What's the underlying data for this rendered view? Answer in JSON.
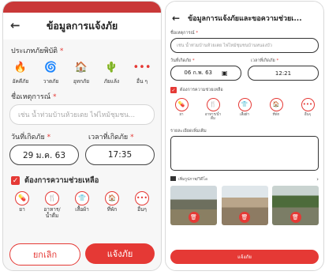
{
  "form_main": {
    "title": "ข้อมูลการแจ้งภัย",
    "type_label": "ประเภทภัยพิบัติ",
    "types": [
      {
        "icon": "fire-icon",
        "glyph": "🔥",
        "label": "อัคคีภัย"
      },
      {
        "icon": "storm-icon",
        "glyph": "🌀",
        "label": "วาตภัย"
      },
      {
        "icon": "flood-icon",
        "glyph": "🏠",
        "label": "อุทกภัย"
      },
      {
        "icon": "drought-icon",
        "glyph": "🌵",
        "label": "ภัยแล้ง"
      },
      {
        "icon": "more-icon",
        "glyph": "•••",
        "label": "อื่น ๆ"
      }
    ],
    "name_label": "ชื่อเหตุการณ์",
    "name_placeholder": "เช่น น้ำท่วมบ้านห้วยเตย ไฟไหม้ชุมชน...",
    "date_label": "วันที่เกิดภัย",
    "time_label": "เวลาที่เกิดภัย",
    "date_value": "29 ม.ค. 63",
    "time_value": "17:35",
    "help_label": "ต้องการความช่วยเหลือ",
    "help_items": [
      {
        "icon": "medicine-icon",
        "glyph": "💊",
        "label": "ยา"
      },
      {
        "icon": "food-icon",
        "glyph": "🍴",
        "label": "อาหาร/น้ำดื่ม"
      },
      {
        "icon": "clothes-icon",
        "glyph": "👕",
        "label": "เสื้อผ้า"
      },
      {
        "icon": "shelter-icon",
        "glyph": "🏠",
        "label": "ที่พัก"
      },
      {
        "icon": "more-icon",
        "glyph": "•••",
        "label": "อื่นๆ"
      }
    ],
    "cancel_label": "ยกเลิก",
    "submit_label": "แจ้งภัย"
  },
  "form_detail": {
    "title": "ข้อมูลการแจ้งภัยและขอความช่วยเ...",
    "name_label": "ชื่อเหตุการณ์",
    "name_placeholder": "เช่น น้ำท่วมบ้านห้วยเตย ไฟไหม้ชุมชนบ้านหนองบัว",
    "date_label": "วันที่เกิดภัย",
    "time_label": "เวลาที่เกิดภัย",
    "date_value": "06 ก.พ. 63",
    "time_value": "12:21",
    "help_label": "ต้องการความช่วยเหลือ",
    "help_items": [
      {
        "icon": "medicine-icon",
        "glyph": "💊",
        "label": "ยา"
      },
      {
        "icon": "food-icon",
        "glyph": "🍴",
        "label": "อาหาร/น้ำดื่ม"
      },
      {
        "icon": "clothes-icon",
        "glyph": "👕",
        "label": "เสื้อผ้า"
      },
      {
        "icon": "shelter-icon",
        "glyph": "🏠",
        "label": "ที่พัก"
      },
      {
        "icon": "more-icon",
        "glyph": "•••",
        "label": "อื่นๆ"
      }
    ],
    "detail_label": "รายละเอียดเพิ่มเติม",
    "photo_label": "เพิ่มรูปภาพ/วิดีโอ",
    "submit_label": "แจ้งภัย"
  },
  "colors": {
    "accent": "#e53935",
    "statusbar": "#c93838"
  }
}
